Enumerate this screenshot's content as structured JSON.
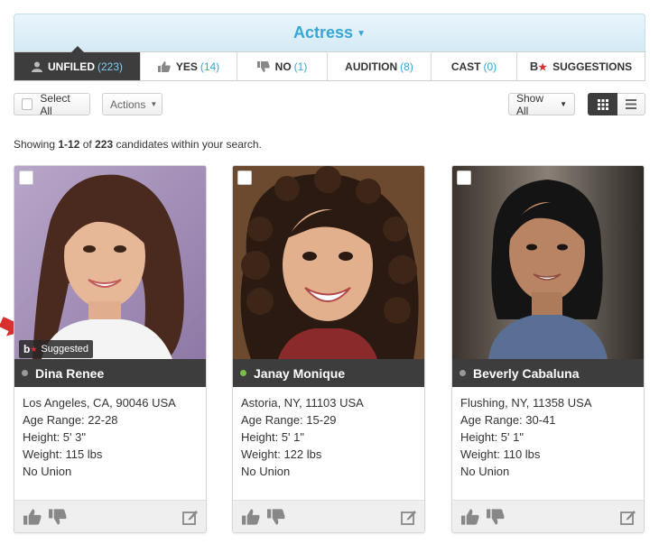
{
  "header": {
    "title": "Actress"
  },
  "tabs": [
    {
      "label": "UNFILED",
      "count": "(223)",
      "icon": "user-icon"
    },
    {
      "label": "YES",
      "count": "(14)",
      "icon": "thumbs-up-icon"
    },
    {
      "label": "NO",
      "count": "(1)",
      "icon": "thumbs-down-icon"
    },
    {
      "label": "AUDITION",
      "count": "(8)"
    },
    {
      "label": "CAST",
      "count": "(0)"
    },
    {
      "label": "SUGGESTIONS",
      "icon": "backstage-logo-icon"
    }
  ],
  "toolbar": {
    "select_all": "Select All",
    "actions": "Actions",
    "show_all": "Show All"
  },
  "showing": {
    "prefix": "Showing ",
    "range": "1-12",
    "of": " of ",
    "total": "223",
    "suffix": " candidates within your search."
  },
  "colors": {
    "accent": "#35a6d5",
    "dark": "#3d3d3d",
    "online": "#7ac143",
    "offline": "#999999",
    "star": "#d9302f"
  },
  "suggested_badge": {
    "label": "Suggested"
  },
  "candidates": [
    {
      "name": "Dina Renee",
      "status": "offline",
      "location": "Los Angeles, CA, 90046 USA",
      "age_range": "Age Range: 22-28",
      "height": "Height: 5' 3\"",
      "weight": "Weight: 115 lbs",
      "union": "No Union",
      "suggested": true
    },
    {
      "name": "Janay Monique",
      "status": "online",
      "location": "Astoria, NY, 11103 USA",
      "age_range": "Age Range: 15-29",
      "height": "Height: 5' 1\"",
      "weight": "Weight: 122 lbs",
      "union": "No Union",
      "suggested": false
    },
    {
      "name": "Beverly Cabaluna",
      "status": "offline",
      "location": "Flushing, NY, 11358 USA",
      "age_range": "Age Range: 30-41",
      "height": "Height: 5' 1\"",
      "weight": "Weight: 110 lbs",
      "union": "No Union",
      "suggested": false
    }
  ]
}
